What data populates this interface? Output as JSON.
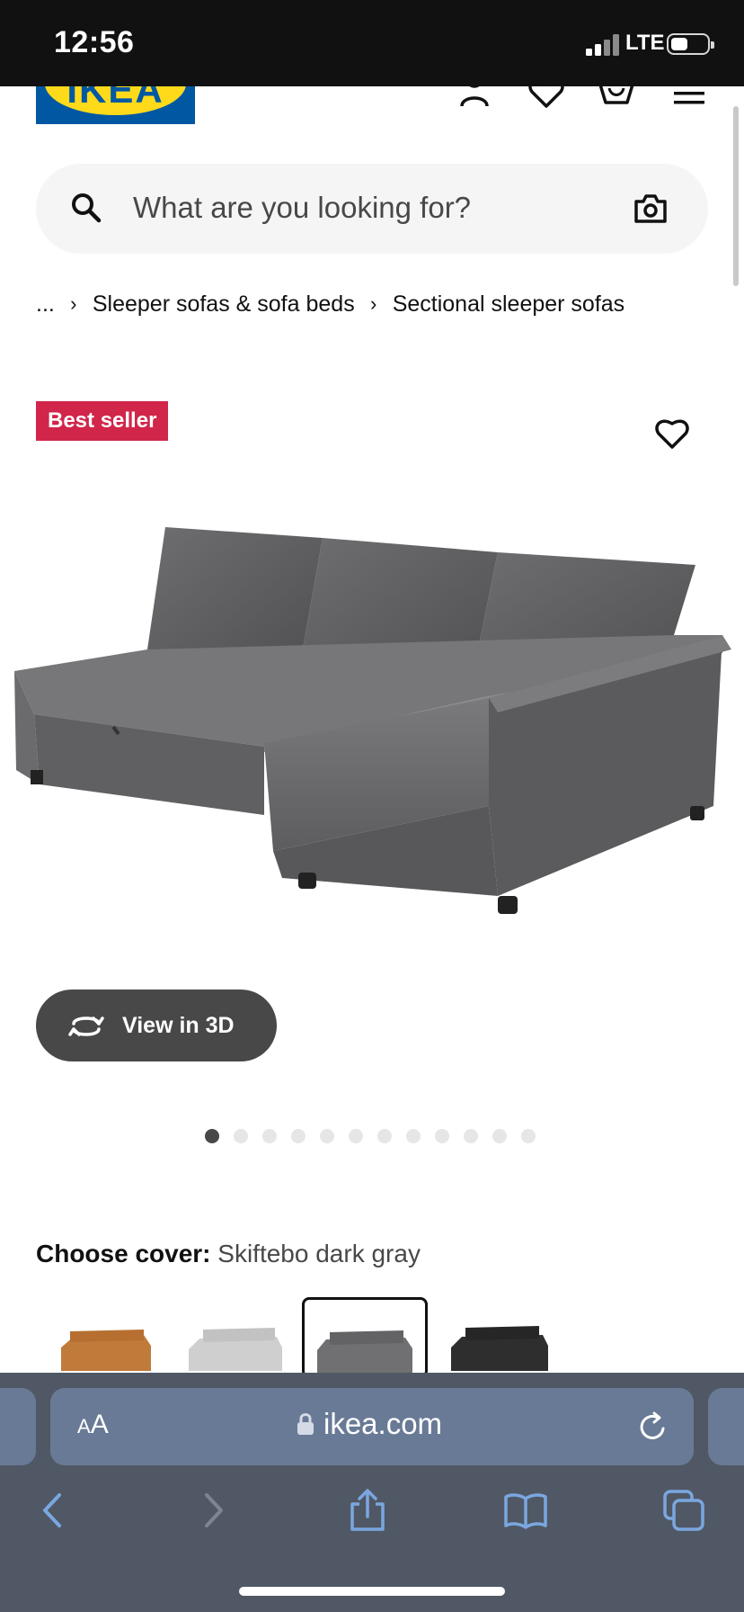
{
  "status_bar": {
    "time": "12:56",
    "network": "LTE"
  },
  "header": {
    "logo_text": "IKEA"
  },
  "search": {
    "placeholder": "What are you looking for?"
  },
  "breadcrumb": {
    "items": [
      "...",
      "Sleeper sofas & sofa beds",
      "Sectional sleeper sofas"
    ]
  },
  "product": {
    "badge": "Best seller",
    "view_3d_label": "View in 3D",
    "image_count": 12,
    "active_image_index": 0,
    "cover_label": "Choose cover:",
    "cover_value": "Skiftebo dark gray",
    "swatches": [
      "orange-brown",
      "light gray",
      "dark gray",
      "black"
    ],
    "selected_swatch_index": 2
  },
  "browser": {
    "aa_label": "AA",
    "url": "ikea.com"
  },
  "colors": {
    "ikea_blue": "#0058a3",
    "ikea_yellow": "#ffda1a",
    "badge_red": "#d1254a",
    "dark_button": "#484848",
    "browser_chrome": "#505865",
    "urlbar": "#697a96",
    "link_blue": "#7aa7e0"
  }
}
